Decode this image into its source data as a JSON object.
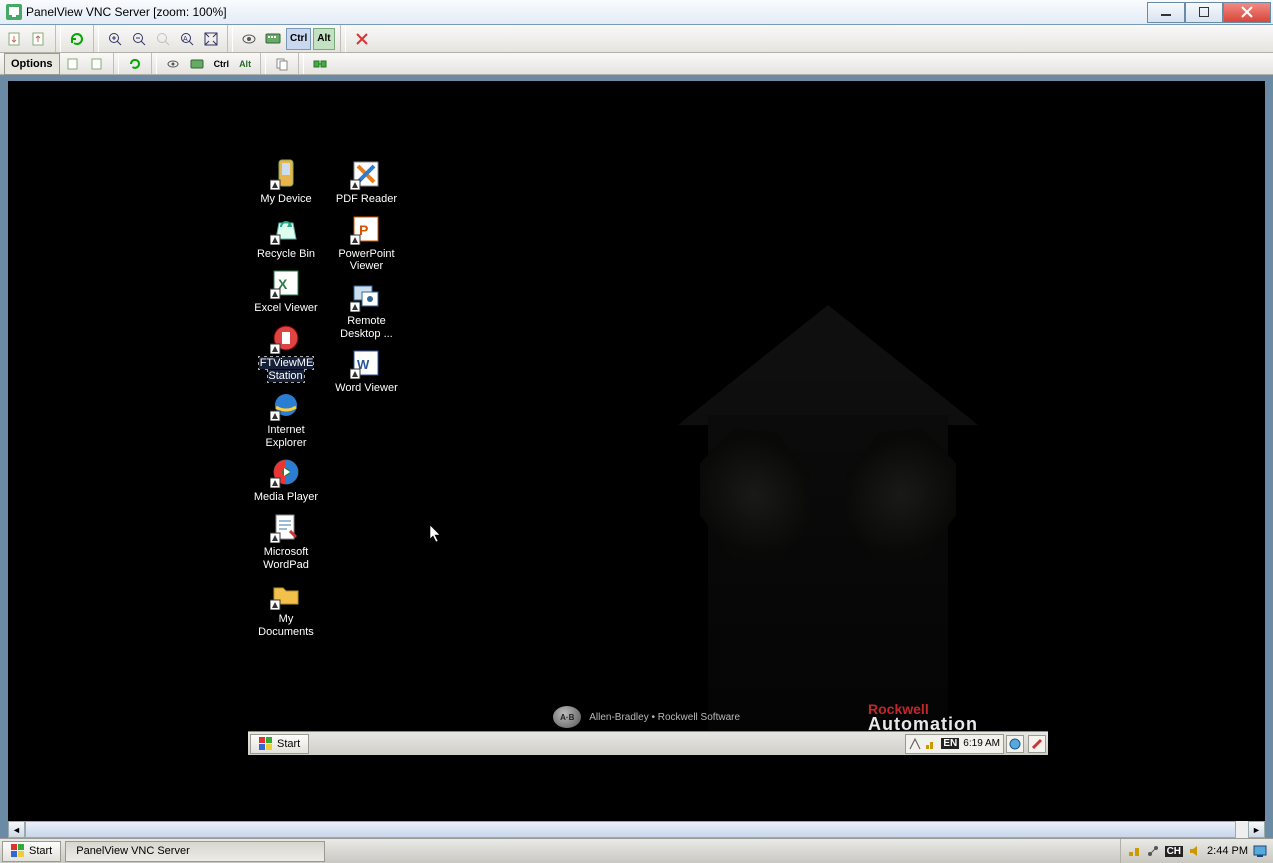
{
  "window": {
    "title": "PanelView VNC Server [zoom: 100%]"
  },
  "toolbar1": {
    "ctrl_label": "Ctrl",
    "alt_label": "Alt"
  },
  "toolbar2": {
    "options_label": "Options",
    "ctrl_label": "Ctrl",
    "alt_label": "Alt"
  },
  "remote": {
    "icons": {
      "col1": [
        {
          "label": "My Device",
          "glyph": "device"
        },
        {
          "label": "Recycle Bin",
          "glyph": "recycle"
        },
        {
          "label": "Excel Viewer",
          "glyph": "excel"
        },
        {
          "label": "FTViewME Station",
          "glyph": "ftview",
          "selected": true
        },
        {
          "label": "Internet Explorer",
          "glyph": "ie"
        },
        {
          "label": "Media Player",
          "glyph": "wmp"
        },
        {
          "label": "Microsoft WordPad",
          "glyph": "wordpad"
        },
        {
          "label": "My Documents",
          "glyph": "folder"
        }
      ],
      "col2": [
        {
          "label": "PDF Reader",
          "glyph": "pdf"
        },
        {
          "label": "PowerPoint Viewer",
          "glyph": "ppt"
        },
        {
          "label": "Remote Desktop ...",
          "glyph": "rdp"
        },
        {
          "label": "Word Viewer",
          "glyph": "word"
        }
      ]
    },
    "brand": {
      "ab_badge": "A·B",
      "line": "Allen-Bradley  •  Rockwell Software",
      "r1": "Rockwell",
      "r2": "Automation"
    },
    "taskbar": {
      "start_label": "Start",
      "lang_badge": "EN",
      "clock": "6:19 AM"
    }
  },
  "host_taskbar": {
    "start_label": "Start",
    "app_button": "PanelView VNC Server",
    "lang_badge": "CH",
    "clock": "2:44 PM"
  }
}
